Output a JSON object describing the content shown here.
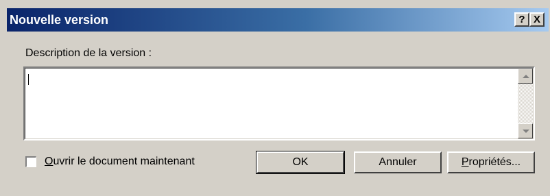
{
  "dialog": {
    "title": "Nouvelle version",
    "help_button": "?",
    "close_button": "X",
    "description_label": "Description de la version :",
    "description_value": "",
    "checkbox": {
      "label_prefix": "",
      "label_mnemonic": "O",
      "label_rest": "uvrir le document maintenant",
      "checked": false
    },
    "buttons": {
      "ok": "OK",
      "cancel": "Annuler",
      "properties_mnemonic": "P",
      "properties_rest": "ropriétés..."
    }
  },
  "colors": {
    "titlebar_start": "#0a246a",
    "titlebar_end": "#a6caf0",
    "face": "#d4d0c8"
  }
}
